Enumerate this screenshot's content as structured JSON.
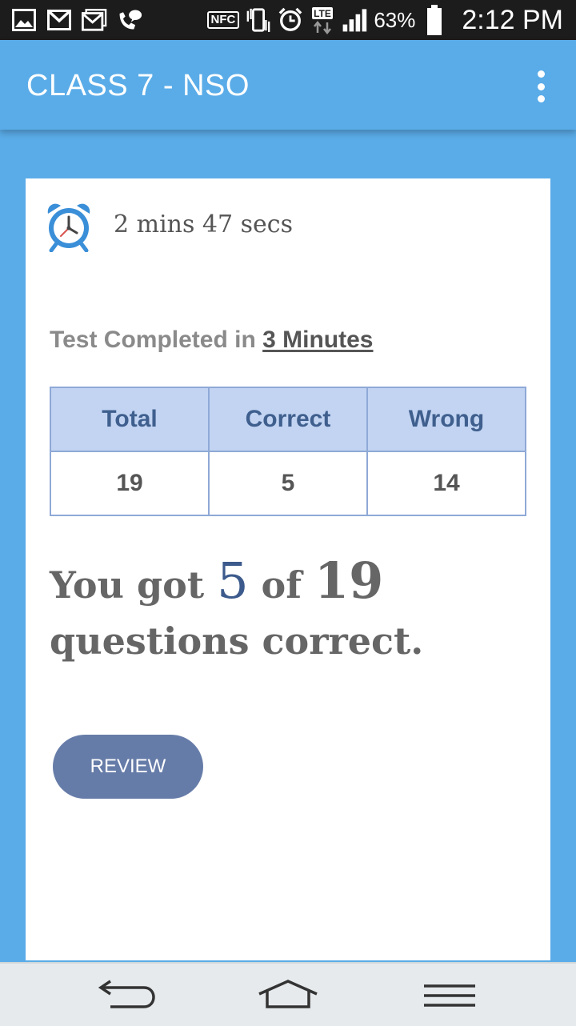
{
  "status_bar": {
    "nfc": "NFC",
    "network": "LTE",
    "battery": "63%",
    "time": "2:12 PM"
  },
  "app_bar": {
    "title": "CLASS 7 - NSO"
  },
  "timer": {
    "text": "2 mins 47 secs"
  },
  "completion": {
    "prefix": "Test Completed in ",
    "duration": "3 Minutes"
  },
  "stats_table": {
    "headers": [
      "Total",
      "Correct",
      "Wrong"
    ],
    "values": [
      "19",
      "5",
      "14"
    ]
  },
  "result": {
    "prefix": "You got ",
    "correct": "5",
    "middle": " of ",
    "total": "19",
    "suffix": "questions correct."
  },
  "review_button": {
    "label": "REVIEW"
  },
  "colors": {
    "app_bar": "#5aace8",
    "header_cell": "#c2d4f2",
    "review_button": "#667ca8"
  }
}
